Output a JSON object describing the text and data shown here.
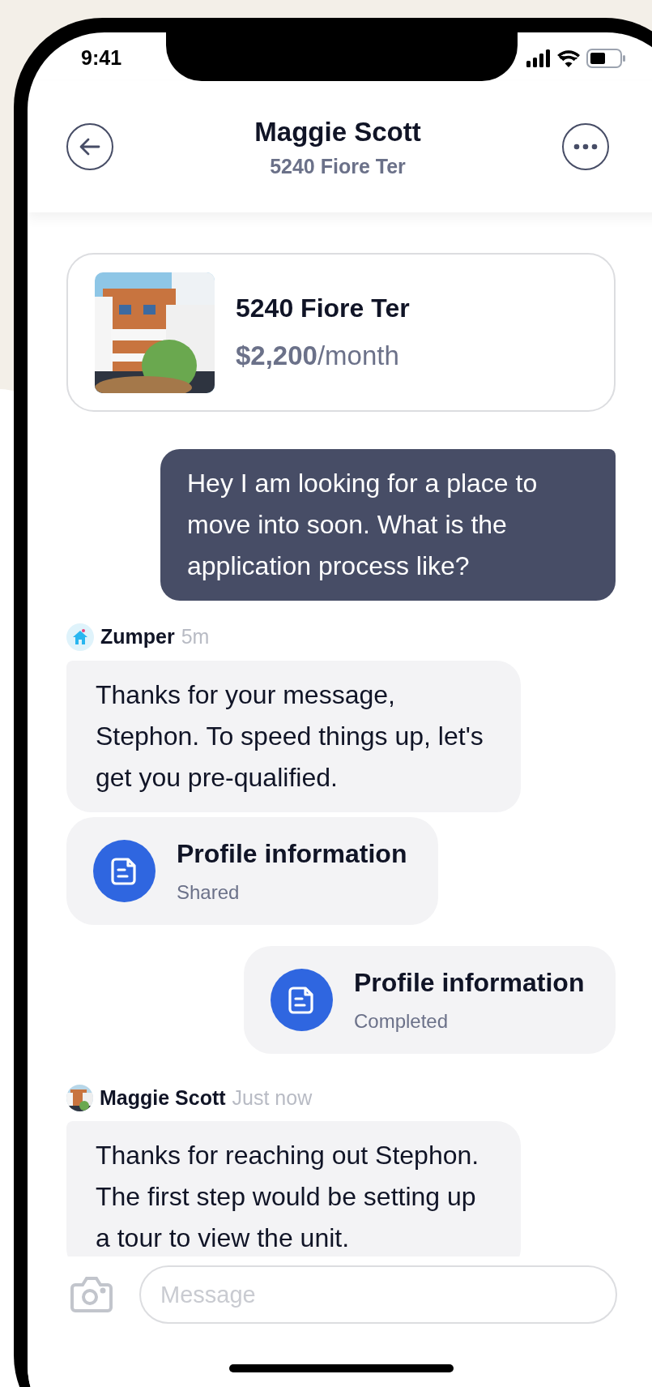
{
  "status_bar": {
    "time": "9:41"
  },
  "header": {
    "title": "Maggie Scott",
    "subtitle": "5240 Fiore Ter"
  },
  "listing": {
    "address": "5240 Fiore Ter",
    "price": "**$2,200**/month"
  },
  "messages": [
    {
      "kind": "text",
      "outgoing": true,
      "text": "Hey I am looking for a place to move into soon. What is the application process like?"
    },
    {
      "kind": "sender",
      "sender": "Zumper",
      "time": "5m"
    },
    {
      "kind": "text",
      "outgoing": false,
      "text": "Thanks for your message, Stephon. To speed things up, let's get you pre-qualified."
    },
    {
      "kind": "attachment",
      "outgoing": false,
      "title": "Profile information",
      "status": "Shared"
    },
    {
      "kind": "attachment",
      "outgoing": true,
      "title": "Profile information",
      "status": "Completed"
    },
    {
      "kind": "sender",
      "sender": "Maggie Scott",
      "time": "Just now"
    },
    {
      "kind": "text",
      "outgoing": false,
      "text": "Thanks for reaching out Stephon. The first step would be setting up a tour to view the unit."
    }
  ],
  "composer": {
    "placeholder": "Message"
  }
}
